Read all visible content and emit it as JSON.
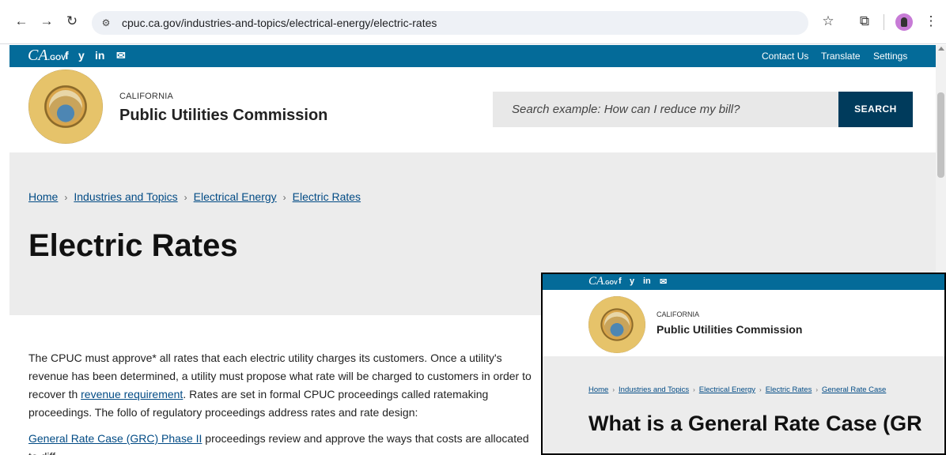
{
  "browser": {
    "url": "cpuc.ca.gov/industries-and-topics/electrical-energy/electric-rates",
    "icons": [
      "back-icon",
      "forward-icon",
      "reload-icon",
      "site-info-icon",
      "bookmark-star-icon",
      "extensions-icon",
      "profile-avatar",
      "menu-icon"
    ]
  },
  "utility_bar": {
    "logo_text": "CA",
    "logo_suffix": ".GOV",
    "links": [
      "Contact Us",
      "Translate",
      "Settings"
    ],
    "social": {
      "facebook": "f",
      "twitter": "y",
      "linkedin": "in",
      "email": "✉"
    },
    "color": "#046b99"
  },
  "header": {
    "agency_small": "CALIFORNIA",
    "agency_name": "Public Utilities Commission",
    "search_placeholder": "Search example: How can I reduce my bill?",
    "search_button": "SEARCH",
    "search_button_color": "#003b5c"
  },
  "breadcrumb": [
    "Home",
    "Industries and Topics",
    "Electrical Energy",
    "Electric Rates"
  ],
  "title": "Electric Rates",
  "body": {
    "p1_part1": "The CPUC must approve* all rates that each electric utility charges its customers. Once a utility's revenue has been determined, a utility must propose what rate will be charged to customers in order to recover th",
    "p1_link": "revenue requirement",
    "p1_part2": ". Rates are set in formal CPUC proceedings called ratemaking proceedings. The follo",
    "p1_part3": "of regulatory proceedings address rates and rate design:",
    "p2_link": "General Rate Case (GRC) Phase II",
    "p2_text": " proceedings review and approve the ways that costs are allocated to diff"
  },
  "overlay": {
    "agency_small": "CALIFORNIA",
    "agency_name": "Public Utilities Commission",
    "breadcrumb": [
      "Home",
      "Industries and Topics",
      "Electrical Energy",
      "Electric Rates",
      "General Rate Case"
    ],
    "title": "What is a General Rate Case (GR"
  }
}
